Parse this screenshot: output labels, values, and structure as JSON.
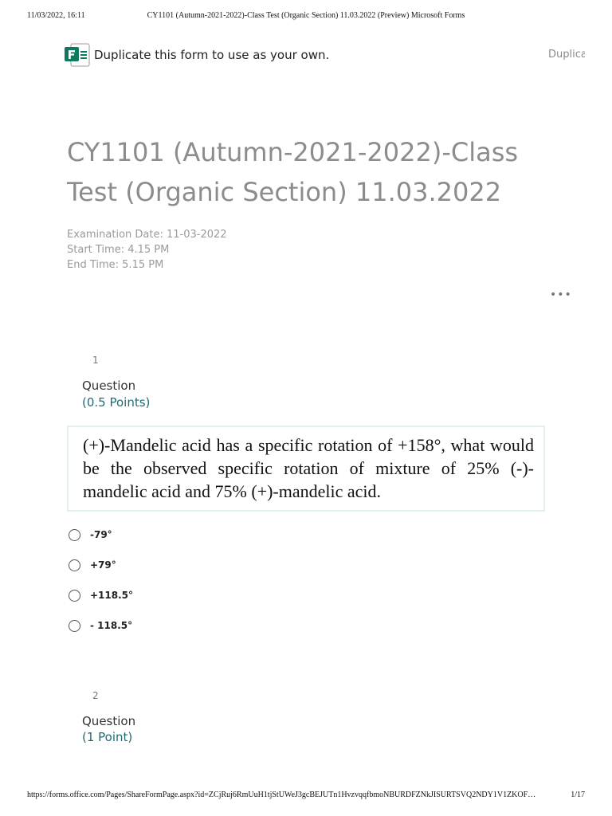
{
  "print_header": {
    "date": "11/03/2022, 16:11",
    "title": "CY1101 (Autumn-2021-2022)-Class Test (Organic Section) 11.03.2022 (Preview) Microsoft Forms"
  },
  "duplicate_bar": {
    "text": "Duplicate this form to use as your own.",
    "link": "Duplicate"
  },
  "form": {
    "title": "CY1101 (Autumn-2021-2022)-Class Test (Organic Section) 11.03.2022",
    "description": [
      "Examination Date: 11-03-2022",
      "Start Time: 4.15 PM",
      "End Time: 5.15 PM"
    ],
    "more_icon": "ellipsis-icon"
  },
  "questions": [
    {
      "number": "1",
      "label": "Question",
      "points": "(0.5 Points)",
      "image_text": "(+)-Mandelic acid has a specific rotation of +158°, what would be the observed specific rotation of mixture of 25% (-)-mandelic acid and 75% (+)-mandelic acid.",
      "options": [
        "-79°",
        "+79°",
        "+118.5°",
        "- 118.5°"
      ]
    },
    {
      "number": "2",
      "label": "Question",
      "points": "(1 Point)"
    }
  ],
  "print_footer": {
    "url": "https://forms.office.com/Pages/ShareFormPage.aspx?id=ZCjRuj6RmUuH1tjStUWeJ3gcBEJUTn1HvzvqqfbmoNBURDFZNkJISURTSVQ2NDY1V1ZKOFlZ…",
    "page": "1/17"
  },
  "colors": {
    "title_gray": "#8c8c8c",
    "points_teal": "#1e6a75",
    "forms_green": "#0b7a5e"
  }
}
